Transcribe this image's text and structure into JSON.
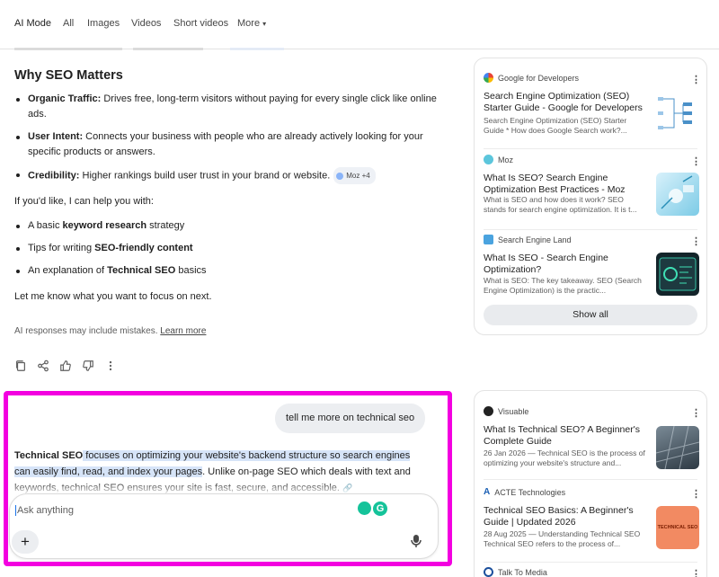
{
  "nav": {
    "items": [
      "AI Mode",
      "All",
      "Images",
      "Videos",
      "Short videos",
      "More"
    ]
  },
  "answer": {
    "section_title": "Why SEO Matters",
    "bullets": [
      {
        "bold": "Organic Traffic:",
        "text": " Drives free, long-term visitors without paying for every single click like online ads."
      },
      {
        "bold": "User Intent:",
        "text": " Connects your business with people who are already actively looking for your specific products or answers."
      },
      {
        "bold": "Credibility:",
        "text": " Higher rankings build user trust in your brand or website."
      }
    ],
    "credibility_chip": "Moz +4",
    "offer": "If you'd like, I can help you with:",
    "offers": [
      {
        "pre": "A basic ",
        "bold": "keyword research",
        "post": " strategy"
      },
      {
        "pre": "Tips for writing ",
        "bold": "SEO-friendly content",
        "post": ""
      },
      {
        "pre": "An explanation of ",
        "bold": "Technical SEO",
        "post": " basics"
      }
    ],
    "closing": "Let me know what you want to focus on next.",
    "disclaimer": "AI responses may include mistakes.",
    "learn_more": "Learn more"
  },
  "sources_top": [
    {
      "site": "Google for Developers",
      "title": "Search Engine Optimization (SEO) Starter Guide - Google for Developers",
      "snippet": "Search Engine Optimization (SEO) Starter Guide * How does Google Search work?..."
    },
    {
      "site": "Moz",
      "title": "What Is SEO? Search Engine Optimization Best Practices - Moz",
      "snippet": "What is SEO and how does it work? SEO stands for search engine optimization. It is t..."
    },
    {
      "site": "Search Engine Land",
      "title": "What Is SEO - Search Engine Optimization?",
      "snippet": "What is SEO: The key takeaway. SEO (Search Engine Optimization) is the practic..."
    }
  ],
  "show_all": "Show all",
  "conversation": {
    "user_message": "tell me more on technical seo",
    "reply_bold": "Technical SEO",
    "reply_highlight": " focuses on optimizing your website's backend structure so search engines can easily find, read, and index your pages",
    "reply_rest": ". Unlike on-page SEO which deals with text and keywords, technical SEO ensures your site is fast, secure, and accessible."
  },
  "composer": {
    "placeholder": "Ask anything",
    "plus": "+"
  },
  "sources_bottom": [
    {
      "site": "Visuable",
      "title": "What Is Technical SEO? A Beginner's Complete Guide",
      "snippet": "26 Jan 2026 — Technical SEO is the process of optimizing your website's structure and..."
    },
    {
      "site": "ACTE Technologies",
      "title": "Technical SEO Basics: A Beginner's Guide | Updated 2026",
      "snippet": "28 Aug 2025 — Understanding Technical SEO Technical SEO refers to the process of...",
      "thumb_text": "TECHNICAL SEO"
    },
    {
      "site": "Talk To Media"
    }
  ],
  "icons": [
    "copy-icon",
    "share-icon",
    "thumbs-up-icon",
    "thumbs-down-icon",
    "more-vert-icon",
    "mic-icon",
    "grammarly-icon"
  ],
  "colors": {
    "highlight_frame": "#f300e0",
    "highlight_text": "#d6e4f8",
    "accent": "#1a73e8"
  }
}
